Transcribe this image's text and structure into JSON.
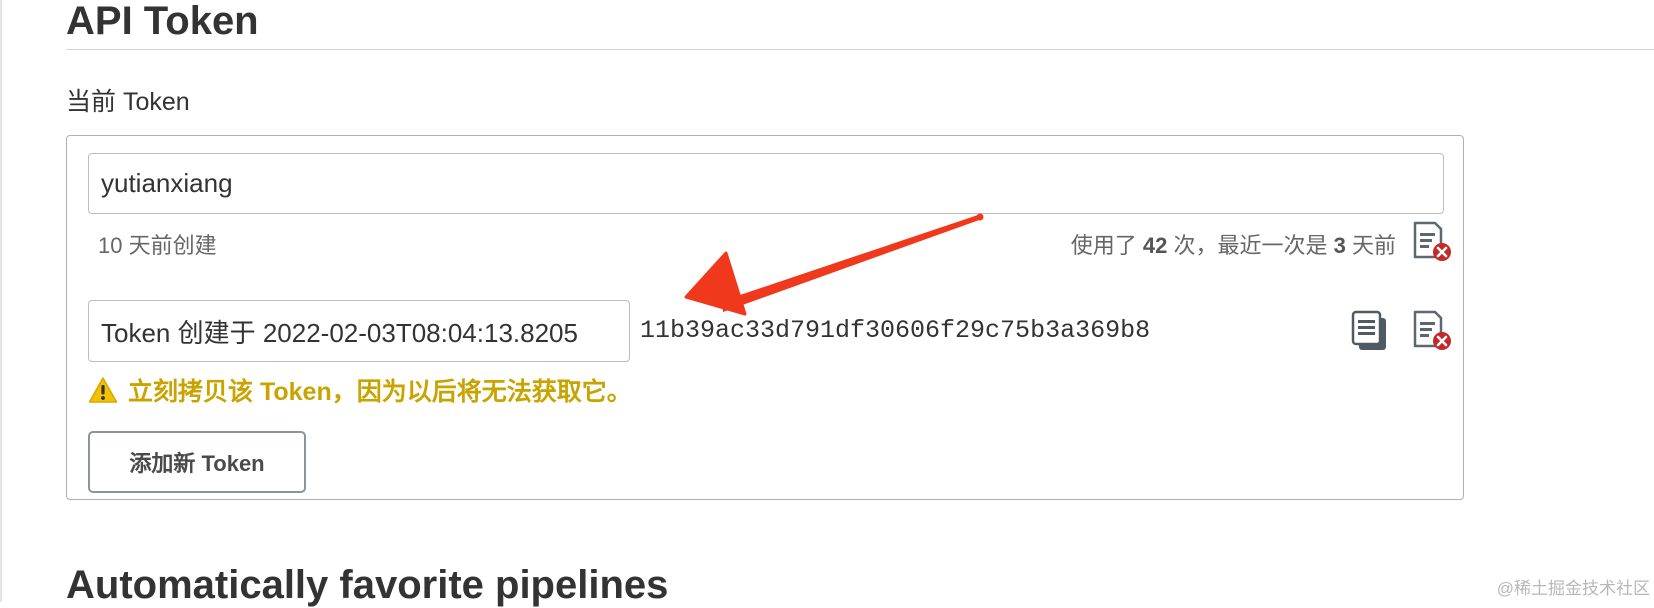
{
  "section": {
    "title": "API Token",
    "current_token_label": "当前 Token"
  },
  "token": {
    "name_value": "yutianxiang",
    "created_ago": "10 天前创建",
    "usage_prefix": "使用了 ",
    "usage_count": "42",
    "usage_middle": " 次，最近一次是 ",
    "last_used_days": "3",
    "usage_suffix": " 天前",
    "new_token_name_value": "Token 创建于 2022-02-03T08:04:13.8205",
    "new_token_value": "11b39ac33d791df30606f29c75b3a369b8",
    "warning": "立刻拷贝该 Token，因为以后将无法获取它。"
  },
  "buttons": {
    "add_new_token": "添加新 Token"
  },
  "next_section": {
    "title": "Automatically favorite pipelines"
  },
  "watermark": "@稀土掘金技术社区",
  "icons": {
    "revoke": "revoke-token-icon",
    "copy": "copy-clipboard-icon",
    "warning": "warning-triangle-icon"
  },
  "colors": {
    "warning_text": "#c9a400",
    "annotation_arrow": "#f0391c",
    "revoke_badge": "#c62828"
  }
}
